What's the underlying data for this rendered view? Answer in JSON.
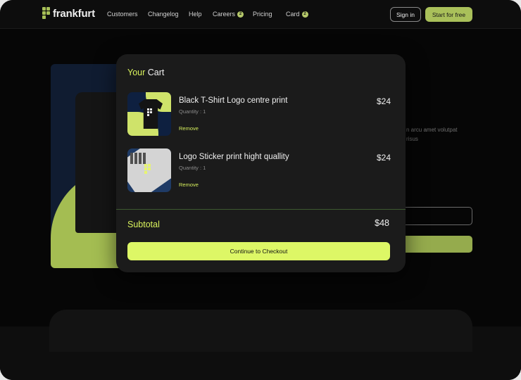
{
  "header": {
    "logo_text": "frankfurt",
    "nav": [
      {
        "label": "Customers"
      },
      {
        "label": "Changelog"
      },
      {
        "label": "Help"
      },
      {
        "label": "Careers",
        "badge": "2"
      },
      {
        "label": "Pricing"
      },
      {
        "label": "Card",
        "badge": "2"
      }
    ],
    "sign_in": "Sign in",
    "start": "Start for free"
  },
  "background": {
    "text_line1": "n arcu amet volutpat",
    "text_line2": "risus"
  },
  "cart": {
    "title_accent": "Your",
    "title_rest": " Cart",
    "items": [
      {
        "name": "Black T-Shirt Logo centre print",
        "quantity": "Quantity : 1",
        "remove": "Remove",
        "price": "$24"
      },
      {
        "name": "Logo Sticker print hight quallity",
        "quantity": "Quantity : 1",
        "remove": "Remove",
        "price": "$24"
      }
    ],
    "subtotal_label": "Subtotal",
    "subtotal_value": "$48",
    "checkout": "Continue to Checkout"
  },
  "colors": {
    "accent": "#d9f25c",
    "brand_green": "#a9c05a",
    "background": "#050505",
    "panel": "#1b1b1b"
  },
  "icons": [
    "logo-grid-icon",
    "tshirt-product-image",
    "laptop-sticker-product-image"
  ]
}
